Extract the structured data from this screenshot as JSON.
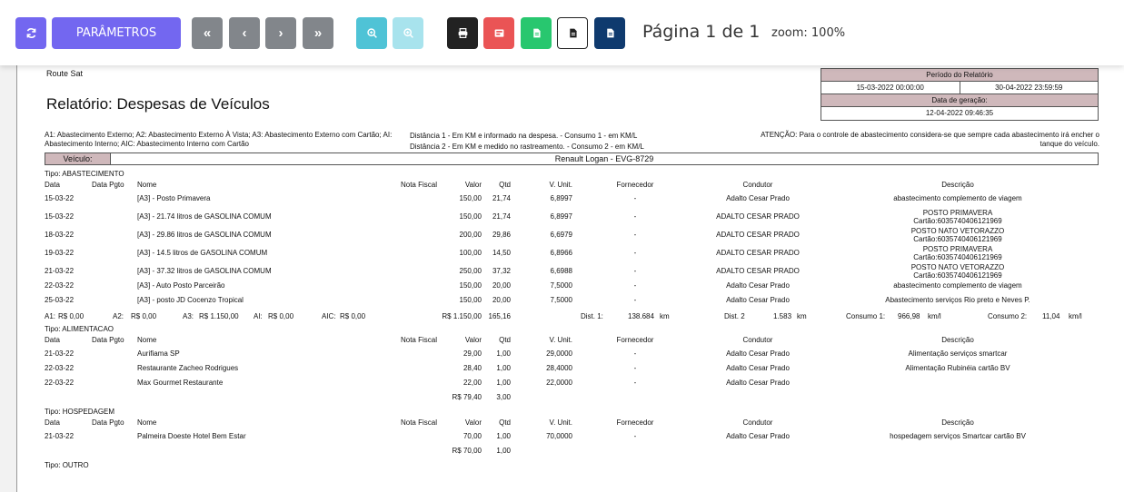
{
  "toolbar": {
    "params_label": "PARÂMETROS",
    "first": "«",
    "prev": "‹",
    "next": "›",
    "last": "»",
    "page_info": "Página 1 de 1",
    "zoom_info": "zoom: 100%",
    "colors": {
      "primary": "#7367f0",
      "secondary": "#82868b",
      "info": "#4fc3d6",
      "danger": "#ea5455",
      "success": "#28c76f",
      "dark": "#222222",
      "navy": "#0f3a6e"
    },
    "icons": [
      "refresh-icon",
      "zoom-in-icon",
      "zoom-out-icon",
      "print-icon",
      "pdf-icon",
      "excel-icon",
      "word-icon",
      "doc-icon"
    ]
  },
  "report": {
    "company": "Route Sat",
    "title": "Relatório: Despesas de Veículos",
    "period_header": "Período do Relatório",
    "period_start": "15-03-2022 00:00:00",
    "period_end": "30-04-2022 23:59:59",
    "gen_header": "Data de geração:",
    "gen_date": "12-04-2022 09:46:35",
    "legend_types": "A1: Abastecimento Externo; A2: Abastecimento Externo À Vista; A3: Abastecimento Externo com Cartão; AI: Abastecimento Interno; AIC: Abastecimento Interno com Cartão",
    "legend_dist1": "Distância 1 - Em KM e informado na despesa. - Consumo 1 - em KM/L",
    "legend_dist2": "Distância 2 - Em KM e medido no rastreamento. - Consumo 2 - em KM/L",
    "attention": "ATENÇÃO: Para o controle de abastecimento considera-se que sempre cada abastecimento irá encher o tanque do veículo.",
    "vehicle_label": "Veículo:",
    "vehicle": "Renault Logan - EVG-8729",
    "headers": {
      "data": "Data",
      "data_pgto": "Data Pgto",
      "nome": "Nome",
      "nota": "Nota Fiscal",
      "valor": "Valor",
      "qtd": "Qtd",
      "vunit": "V. Unit.",
      "fornecedor": "Fornecedor",
      "condutor": "Condutor",
      "descricao": "Descrição"
    },
    "sections": [
      {
        "title": "Tipo: ABASTECIMENTO",
        "rows": [
          {
            "data": "15-03-22",
            "nome": "[A3] - Posto Primavera",
            "valor": "150,00",
            "qtd": "21,74",
            "vunit": "6,8997",
            "fornecedor": "-",
            "condutor": "Adalto Cesar Prado",
            "desc1": "abastecimento complemento de viagem",
            "desc2": ""
          },
          {
            "data": "15-03-22",
            "nome": "[A3] - 21.74 litros de GASOLINA COMUM",
            "valor": "150,00",
            "qtd": "21,74",
            "vunit": "6,8997",
            "fornecedor": "-",
            "condutor": "ADALTO CESAR PRADO",
            "desc1": "POSTO PRIMAVERA",
            "desc2": "Cartão:6035740406121969"
          },
          {
            "data": "18-03-22",
            "nome": "[A3] - 29.86 litros de GASOLINA COMUM",
            "valor": "200,00",
            "qtd": "29,86",
            "vunit": "6,6979",
            "fornecedor": "-",
            "condutor": "ADALTO CESAR PRADO",
            "desc1": "POSTO NATO VETORAZZO",
            "desc2": "Cartão:6035740406121969"
          },
          {
            "data": "19-03-22",
            "nome": "[A3] - 14.5 litros de GASOLINA COMUM",
            "valor": "100,00",
            "qtd": "14,50",
            "vunit": "6,8966",
            "fornecedor": "-",
            "condutor": "ADALTO CESAR PRADO",
            "desc1": "POSTO PRIMAVERA",
            "desc2": "Cartão:6035740406121969"
          },
          {
            "data": "21-03-22",
            "nome": "[A3] - 37.32 litros de GASOLINA COMUM",
            "valor": "250,00",
            "qtd": "37,32",
            "vunit": "6,6988",
            "fornecedor": "-",
            "condutor": "ADALTO CESAR PRADO",
            "desc1": "POSTO NATO VETORAZZO",
            "desc2": "Cartão:6035740406121969"
          },
          {
            "data": "22-03-22",
            "nome": "[A3] - Auto Posto Parceirão",
            "valor": "150,00",
            "qtd": "20,00",
            "vunit": "7,5000",
            "fornecedor": "-",
            "condutor": "Adalto Cesar Prado",
            "desc1": "abastecimento complemento de viagem",
            "desc2": ""
          },
          {
            "data": "25-03-22",
            "nome": "[A3] - posto JD Cocenzo Tropical",
            "valor": "150,00",
            "qtd": "20,00",
            "vunit": "7,5000",
            "fornecedor": "-",
            "condutor": "Adalto Cesar Prado",
            "desc1": "Abastecimento serviços Rio preto e Neves P.",
            "desc2": ""
          }
        ],
        "summary": {
          "a1_label": "A1:",
          "a1": "R$ 0,00",
          "a2_label": "A2:",
          "a2": "R$ 0,00",
          "a3_label": "A3:",
          "a3": "R$ 1.150,00",
          "ai_label": "AI:",
          "ai": "R$ 0,00",
          "aic_label": "AIC:",
          "aic": "R$ 0,00",
          "total": "R$ 1.150,00",
          "qtd": "165,16",
          "dist1_label": "Dist. 1:",
          "dist1": "138.684",
          "dist1_unit": "km",
          "dist2_label": "Dist. 2",
          "dist2": "1.583",
          "dist2_unit": "km",
          "cons1_label": "Consumo 1:",
          "cons1": "966,98",
          "cons1_unit": "km/l",
          "cons2_label": "Consumo 2:",
          "cons2": "11,04",
          "cons2_unit": "km/l"
        }
      },
      {
        "title": "Tipo: ALIMENTACAO",
        "rows": [
          {
            "data": "21-03-22",
            "nome": "Aurifiama SP",
            "valor": "29,00",
            "qtd": "1,00",
            "vunit": "29,0000",
            "fornecedor": "-",
            "condutor": "Adalto Cesar Prado",
            "desc1": "Alimentação serviços smartcar",
            "desc2": ""
          },
          {
            "data": "22-03-22",
            "nome": "Restaurante Zacheo Rodrigues",
            "valor": "28,40",
            "qtd": "1,00",
            "vunit": "28,4000",
            "fornecedor": "-",
            "condutor": "Adalto Cesar Prado",
            "desc1": "Alimentação Rubinéia cartão BV",
            "desc2": ""
          },
          {
            "data": "22-03-22",
            "nome": "Max Gourmet Restaurante",
            "valor": "22,00",
            "qtd": "1,00",
            "vunit": "22,0000",
            "fornecedor": "-",
            "condutor": "Adalto Cesar Prado",
            "desc1": "",
            "desc2": ""
          }
        ],
        "summary": {
          "total": "R$ 79,40",
          "qtd": "3,00"
        }
      },
      {
        "title": "Tipo: HOSPEDAGEM",
        "rows": [
          {
            "data": "21-03-22",
            "nome": "Palmeira Doeste Hotel Bem Estar",
            "valor": "70,00",
            "qtd": "1,00",
            "vunit": "70,0000",
            "fornecedor": "-",
            "condutor": "Adalto Cesar Prado",
            "desc1": "hospedagem serviços Smartcar cartão BV",
            "desc2": ""
          }
        ],
        "summary": {
          "total": "R$ 70,00",
          "qtd": "1,00"
        }
      },
      {
        "title": "Tipo: OUTRO",
        "rows": [],
        "summary": null
      }
    ]
  }
}
